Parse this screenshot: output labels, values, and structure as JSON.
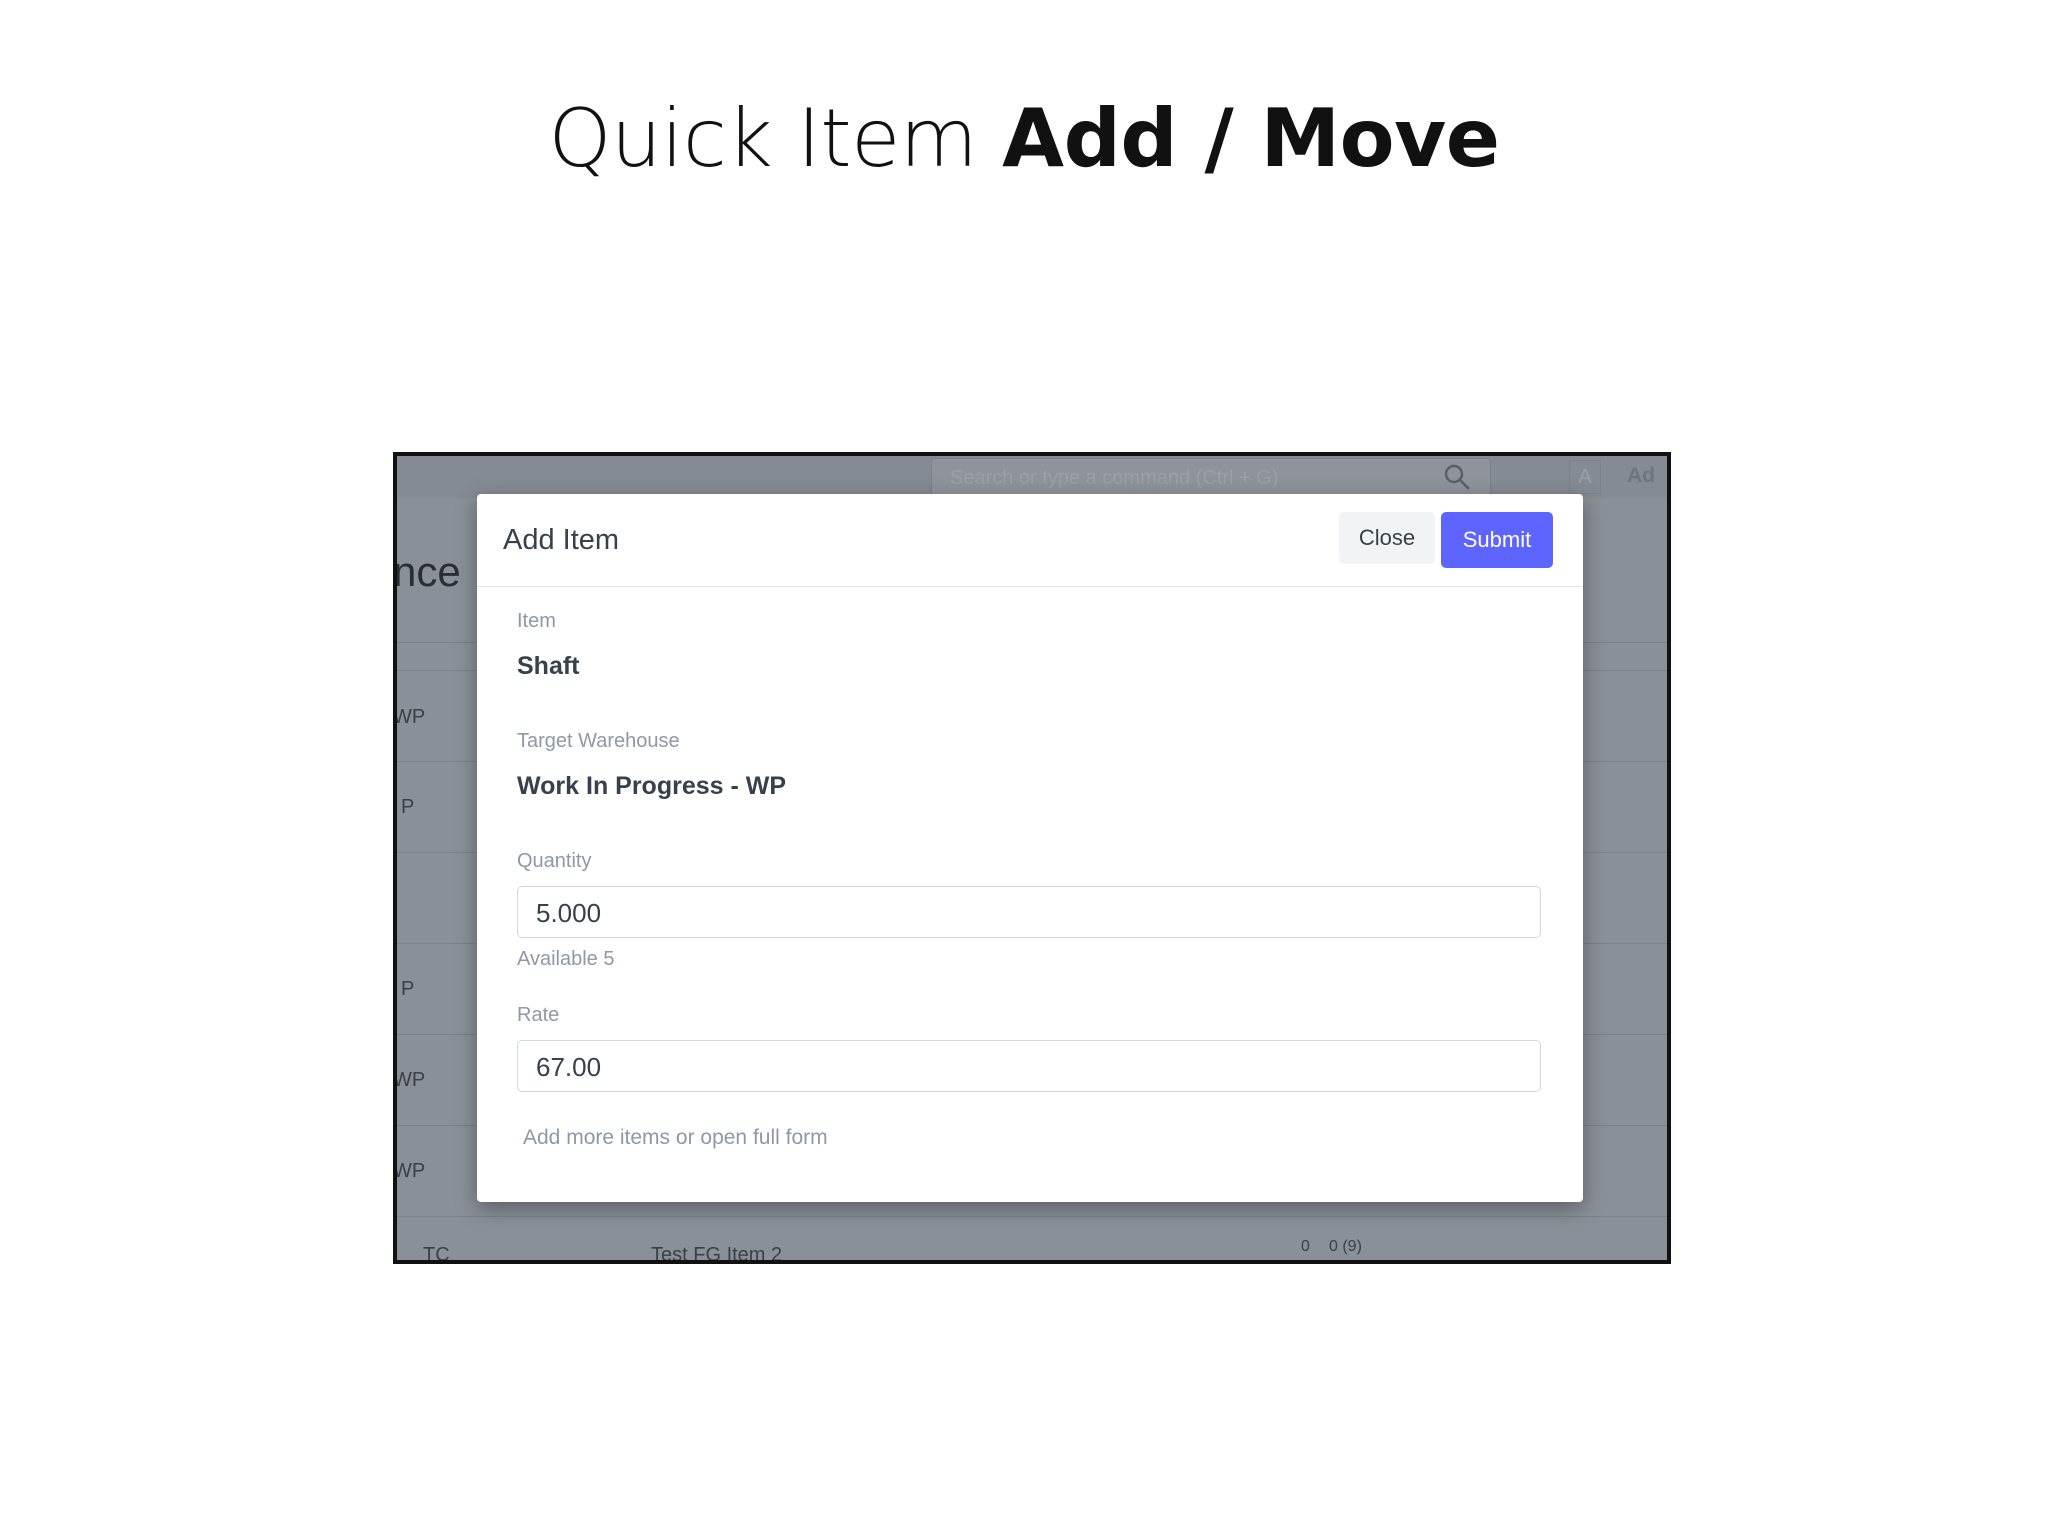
{
  "slide": {
    "title_light": "Quick Item ",
    "title_bold": "Add / Move"
  },
  "topbar": {
    "search_placeholder": "Search or type a command (Ctrl + G)",
    "avatar_letter": "A",
    "add_link": "Ad"
  },
  "background": {
    "heading": "nce",
    "row_codes": [
      "WP",
      "P",
      "P",
      "WP",
      "WP"
    ],
    "bottom_row": {
      "code": "TC",
      "item": "Test FG Item 2",
      "qty_a": "0",
      "qty_b": "0 (9)"
    }
  },
  "modal": {
    "title": "Add Item",
    "close_label": "Close",
    "submit_label": "Submit",
    "item_label": "Item",
    "item_value": "Shaft",
    "warehouse_label": "Target Warehouse",
    "warehouse_value": "Work In Progress - WP",
    "quantity_label": "Quantity",
    "quantity_value": "5.000",
    "available_text": "Available 5",
    "rate_label": "Rate",
    "rate_value": "67.00",
    "footer_link": "Add more items or open full form"
  },
  "colors": {
    "primary": "#5e64ff",
    "label": "#8d99a6",
    "text": "#36414c"
  }
}
